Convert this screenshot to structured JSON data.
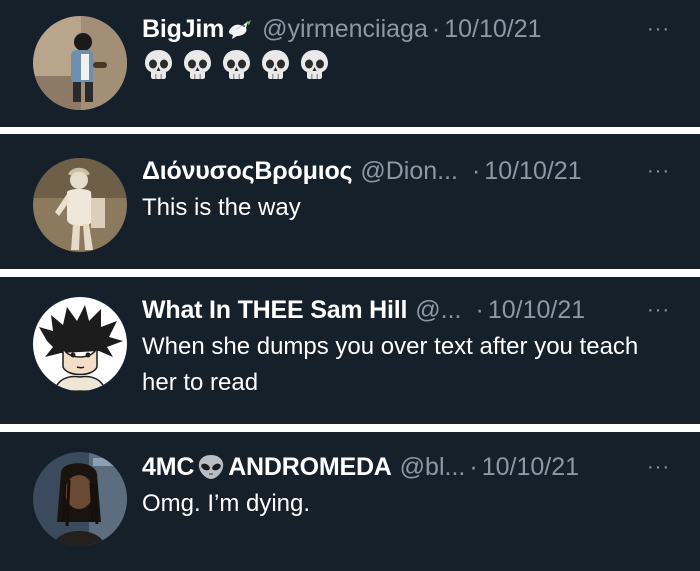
{
  "tweets": [
    {
      "name": "BigJim",
      "name_emoji": "dove-icon",
      "handle": "@yirmenciiaga",
      "separator": "·",
      "date": "10/10/21",
      "more": "···",
      "text": "",
      "reaction_emojis": [
        "💀",
        "💀",
        "💀",
        "💀",
        "💀"
      ]
    },
    {
      "name": "ΔιόνυσοςΒρόμιος",
      "handle": "@Dion...",
      "separator": "·",
      "date": "10/10/21",
      "more": "···",
      "text": "This is the way"
    },
    {
      "name": "What In THEE Sam Hill",
      "handle": "@...",
      "separator": "·",
      "date": "10/10/21",
      "more": "···",
      "text": "When she dumps you over text after you teach her to read"
    },
    {
      "name_prefix": "4MC",
      "name_emoji": "alien-icon",
      "name": "ANDROMEDA",
      "handle": "@bl...",
      "separator": "·",
      "date": "10/10/21",
      "more": "···",
      "text": "Omg. I’m dying."
    }
  ],
  "colors": {
    "background": "#15202b",
    "divider": "#ffffff",
    "name": "#ffffff",
    "meta": "#8b98a5",
    "body": "#ffffff"
  }
}
